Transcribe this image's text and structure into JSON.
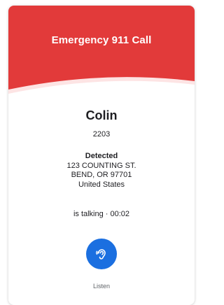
{
  "header": {
    "title": "Emergency 911 Call",
    "color": "#e23a3a"
  },
  "caller": {
    "name": "Colin",
    "extension": "2203"
  },
  "location": {
    "label": "Detected",
    "street": "123 COUNTING ST.",
    "city": "BEND, OR 97701",
    "country": "United States"
  },
  "call": {
    "status": "is talking · 00:02"
  },
  "actions": {
    "listen_label": "Listen",
    "listen_icon": "ear-listen-icon",
    "listen_color": "#1b6fe0"
  }
}
